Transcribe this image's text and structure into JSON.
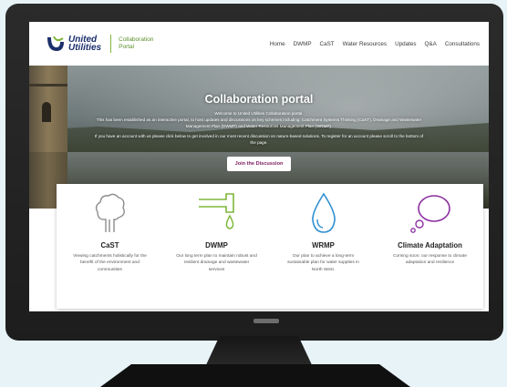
{
  "brand": {
    "logo_line1": "United",
    "logo_line2": "Utilities",
    "portal_line1": "Collaboration",
    "portal_line2": "Portal",
    "colors": {
      "navy": "#1b2f6b",
      "green": "#7fb73a",
      "purple": "#7a1c5c"
    }
  },
  "nav": {
    "items": [
      "Home",
      "DWMP",
      "CaST",
      "Water Resources",
      "Updates",
      "Q&A",
      "Consultations"
    ]
  },
  "hero": {
    "title": "Collaboration portal",
    "welcome": "Welcome to United Utilities Collaboration portal.",
    "intro": "This has been established as an interactive portal, to host updates and discussions on key schemes including: Catchment Systems Thinking (CaST), Drainage and Wastewater Management Plan (DWMP) and Water Resources Management Plan (WRMP).",
    "account": "If you have an account with us please click below to get involved in our most recent discussion on nature-based solutions. To register for an account please scroll to the bottom of the page.",
    "cta_label": "Join the Discussion"
  },
  "cards": [
    {
      "icon": "tree-icon",
      "color": "#8c8c8c",
      "title": "CaST",
      "desc": "Viewing catchments holistically for the benefit of the environment and communities"
    },
    {
      "icon": "pipe-drop-icon",
      "color": "#7fb73a",
      "title": "DWMP",
      "desc": "Our long term plan to maintain robust and resilient drainage and wastewater services"
    },
    {
      "icon": "water-drop-icon",
      "color": "#2f8fd0",
      "title": "WRMP",
      "desc": "Our plan to achieve a long-term sustainable plan for water supplies in North West."
    },
    {
      "icon": "thought-bubble-icon",
      "color": "#8b2fa0",
      "title": "Climate Adaptation",
      "desc": "Coming soon: our response to climate adaptation and resilience"
    }
  ]
}
